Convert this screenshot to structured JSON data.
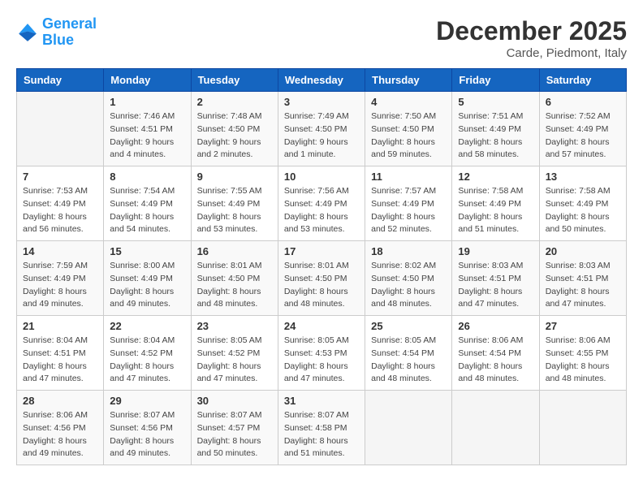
{
  "header": {
    "logo_line1": "General",
    "logo_line2": "Blue",
    "month": "December 2025",
    "location": "Carde, Piedmont, Italy"
  },
  "weekdays": [
    "Sunday",
    "Monday",
    "Tuesday",
    "Wednesday",
    "Thursday",
    "Friday",
    "Saturday"
  ],
  "weeks": [
    [
      {
        "day": "",
        "info": ""
      },
      {
        "day": "1",
        "info": "Sunrise: 7:46 AM\nSunset: 4:51 PM\nDaylight: 9 hours\nand 4 minutes."
      },
      {
        "day": "2",
        "info": "Sunrise: 7:48 AM\nSunset: 4:50 PM\nDaylight: 9 hours\nand 2 minutes."
      },
      {
        "day": "3",
        "info": "Sunrise: 7:49 AM\nSunset: 4:50 PM\nDaylight: 9 hours\nand 1 minute."
      },
      {
        "day": "4",
        "info": "Sunrise: 7:50 AM\nSunset: 4:50 PM\nDaylight: 8 hours\nand 59 minutes."
      },
      {
        "day": "5",
        "info": "Sunrise: 7:51 AM\nSunset: 4:49 PM\nDaylight: 8 hours\nand 58 minutes."
      },
      {
        "day": "6",
        "info": "Sunrise: 7:52 AM\nSunset: 4:49 PM\nDaylight: 8 hours\nand 57 minutes."
      }
    ],
    [
      {
        "day": "7",
        "info": "Sunrise: 7:53 AM\nSunset: 4:49 PM\nDaylight: 8 hours\nand 56 minutes."
      },
      {
        "day": "8",
        "info": "Sunrise: 7:54 AM\nSunset: 4:49 PM\nDaylight: 8 hours\nand 54 minutes."
      },
      {
        "day": "9",
        "info": "Sunrise: 7:55 AM\nSunset: 4:49 PM\nDaylight: 8 hours\nand 53 minutes."
      },
      {
        "day": "10",
        "info": "Sunrise: 7:56 AM\nSunset: 4:49 PM\nDaylight: 8 hours\nand 53 minutes."
      },
      {
        "day": "11",
        "info": "Sunrise: 7:57 AM\nSunset: 4:49 PM\nDaylight: 8 hours\nand 52 minutes."
      },
      {
        "day": "12",
        "info": "Sunrise: 7:58 AM\nSunset: 4:49 PM\nDaylight: 8 hours\nand 51 minutes."
      },
      {
        "day": "13",
        "info": "Sunrise: 7:58 AM\nSunset: 4:49 PM\nDaylight: 8 hours\nand 50 minutes."
      }
    ],
    [
      {
        "day": "14",
        "info": "Sunrise: 7:59 AM\nSunset: 4:49 PM\nDaylight: 8 hours\nand 49 minutes."
      },
      {
        "day": "15",
        "info": "Sunrise: 8:00 AM\nSunset: 4:49 PM\nDaylight: 8 hours\nand 49 minutes."
      },
      {
        "day": "16",
        "info": "Sunrise: 8:01 AM\nSunset: 4:50 PM\nDaylight: 8 hours\nand 48 minutes."
      },
      {
        "day": "17",
        "info": "Sunrise: 8:01 AM\nSunset: 4:50 PM\nDaylight: 8 hours\nand 48 minutes."
      },
      {
        "day": "18",
        "info": "Sunrise: 8:02 AM\nSunset: 4:50 PM\nDaylight: 8 hours\nand 48 minutes."
      },
      {
        "day": "19",
        "info": "Sunrise: 8:03 AM\nSunset: 4:51 PM\nDaylight: 8 hours\nand 47 minutes."
      },
      {
        "day": "20",
        "info": "Sunrise: 8:03 AM\nSunset: 4:51 PM\nDaylight: 8 hours\nand 47 minutes."
      }
    ],
    [
      {
        "day": "21",
        "info": "Sunrise: 8:04 AM\nSunset: 4:51 PM\nDaylight: 8 hours\nand 47 minutes."
      },
      {
        "day": "22",
        "info": "Sunrise: 8:04 AM\nSunset: 4:52 PM\nDaylight: 8 hours\nand 47 minutes."
      },
      {
        "day": "23",
        "info": "Sunrise: 8:05 AM\nSunset: 4:52 PM\nDaylight: 8 hours\nand 47 minutes."
      },
      {
        "day": "24",
        "info": "Sunrise: 8:05 AM\nSunset: 4:53 PM\nDaylight: 8 hours\nand 47 minutes."
      },
      {
        "day": "25",
        "info": "Sunrise: 8:05 AM\nSunset: 4:54 PM\nDaylight: 8 hours\nand 48 minutes."
      },
      {
        "day": "26",
        "info": "Sunrise: 8:06 AM\nSunset: 4:54 PM\nDaylight: 8 hours\nand 48 minutes."
      },
      {
        "day": "27",
        "info": "Sunrise: 8:06 AM\nSunset: 4:55 PM\nDaylight: 8 hours\nand 48 minutes."
      }
    ],
    [
      {
        "day": "28",
        "info": "Sunrise: 8:06 AM\nSunset: 4:56 PM\nDaylight: 8 hours\nand 49 minutes."
      },
      {
        "day": "29",
        "info": "Sunrise: 8:07 AM\nSunset: 4:56 PM\nDaylight: 8 hours\nand 49 minutes."
      },
      {
        "day": "30",
        "info": "Sunrise: 8:07 AM\nSunset: 4:57 PM\nDaylight: 8 hours\nand 50 minutes."
      },
      {
        "day": "31",
        "info": "Sunrise: 8:07 AM\nSunset: 4:58 PM\nDaylight: 8 hours\nand 51 minutes."
      },
      {
        "day": "",
        "info": ""
      },
      {
        "day": "",
        "info": ""
      },
      {
        "day": "",
        "info": ""
      }
    ]
  ]
}
